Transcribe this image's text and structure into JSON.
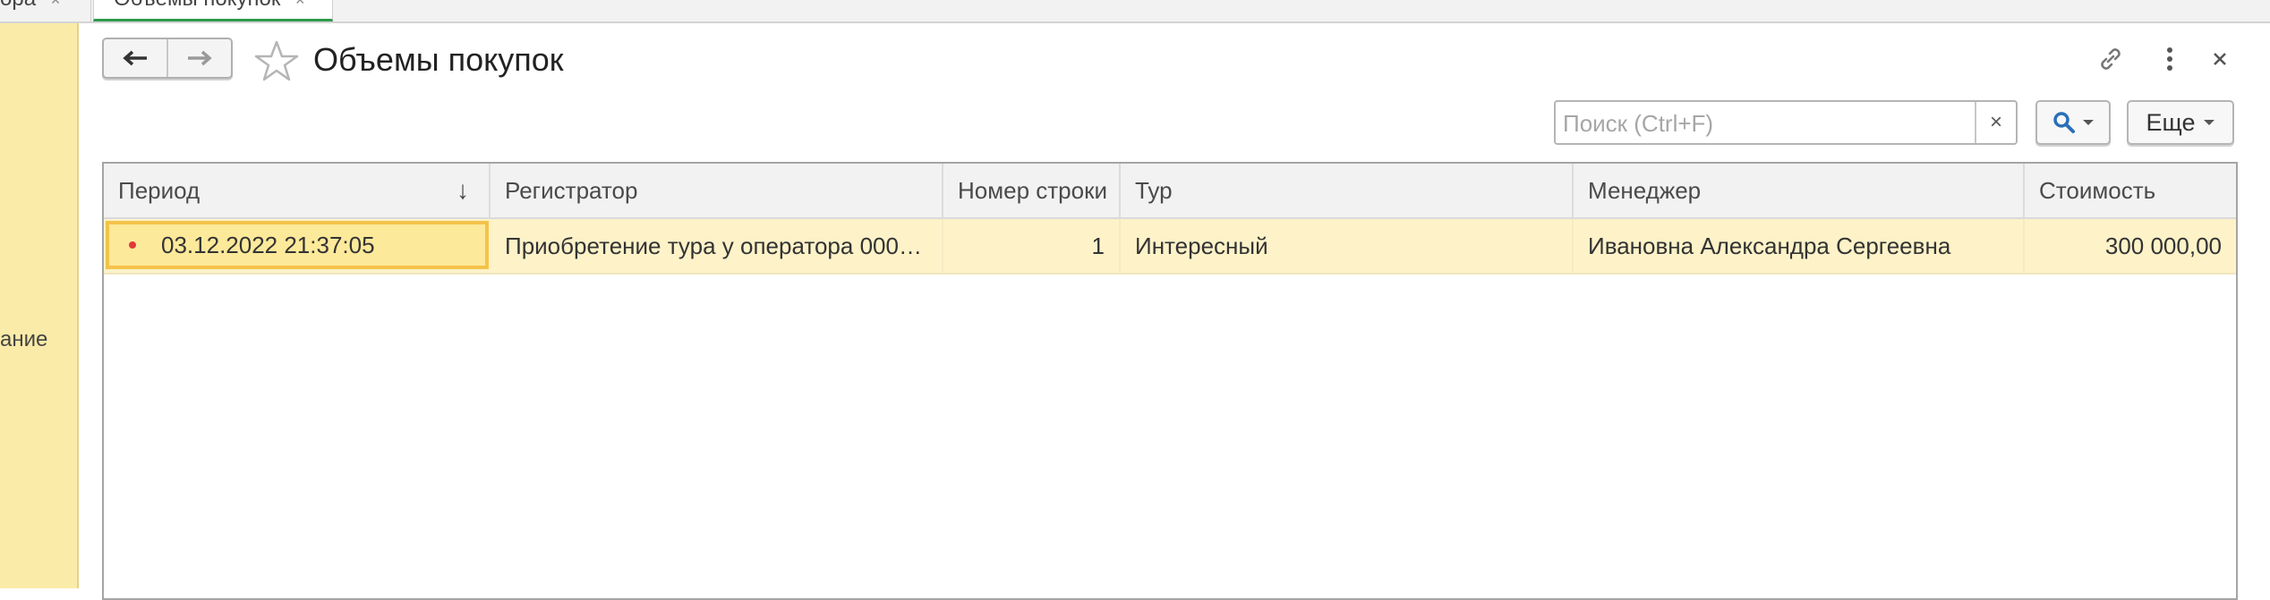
{
  "tabs": [
    {
      "label": "ора",
      "close": "×"
    },
    {
      "label": "Объемы покупок",
      "close": "×"
    }
  ],
  "sidebar": {
    "partial_label": "ание"
  },
  "header": {
    "title": "Объемы покупок"
  },
  "toolbar": {
    "search_placeholder": "Поиск (Ctrl+F)",
    "clear_label": "×",
    "more_label": "Еще"
  },
  "table": {
    "columns": [
      "Период",
      "Регистратор",
      "Номер строки",
      "Тур",
      "Менеджер",
      "Стоимость"
    ],
    "sort_indicator": "↓",
    "rows": [
      {
        "period": "03.12.2022 21:37:05",
        "registrar": "Приобретение тура у оператора 0000...",
        "line_number": "1",
        "tour": "Интересный",
        "manager": "Ивановна Александра Сергеевна",
        "cost": "300 000,00"
      }
    ]
  },
  "colors": {
    "sidebar": "#fbeba8",
    "selected_row": "#fdf2c8",
    "active_cell_border": "#f3c34a",
    "tab_accent": "#2e9b4c",
    "record_dot": "#e03a3a"
  }
}
